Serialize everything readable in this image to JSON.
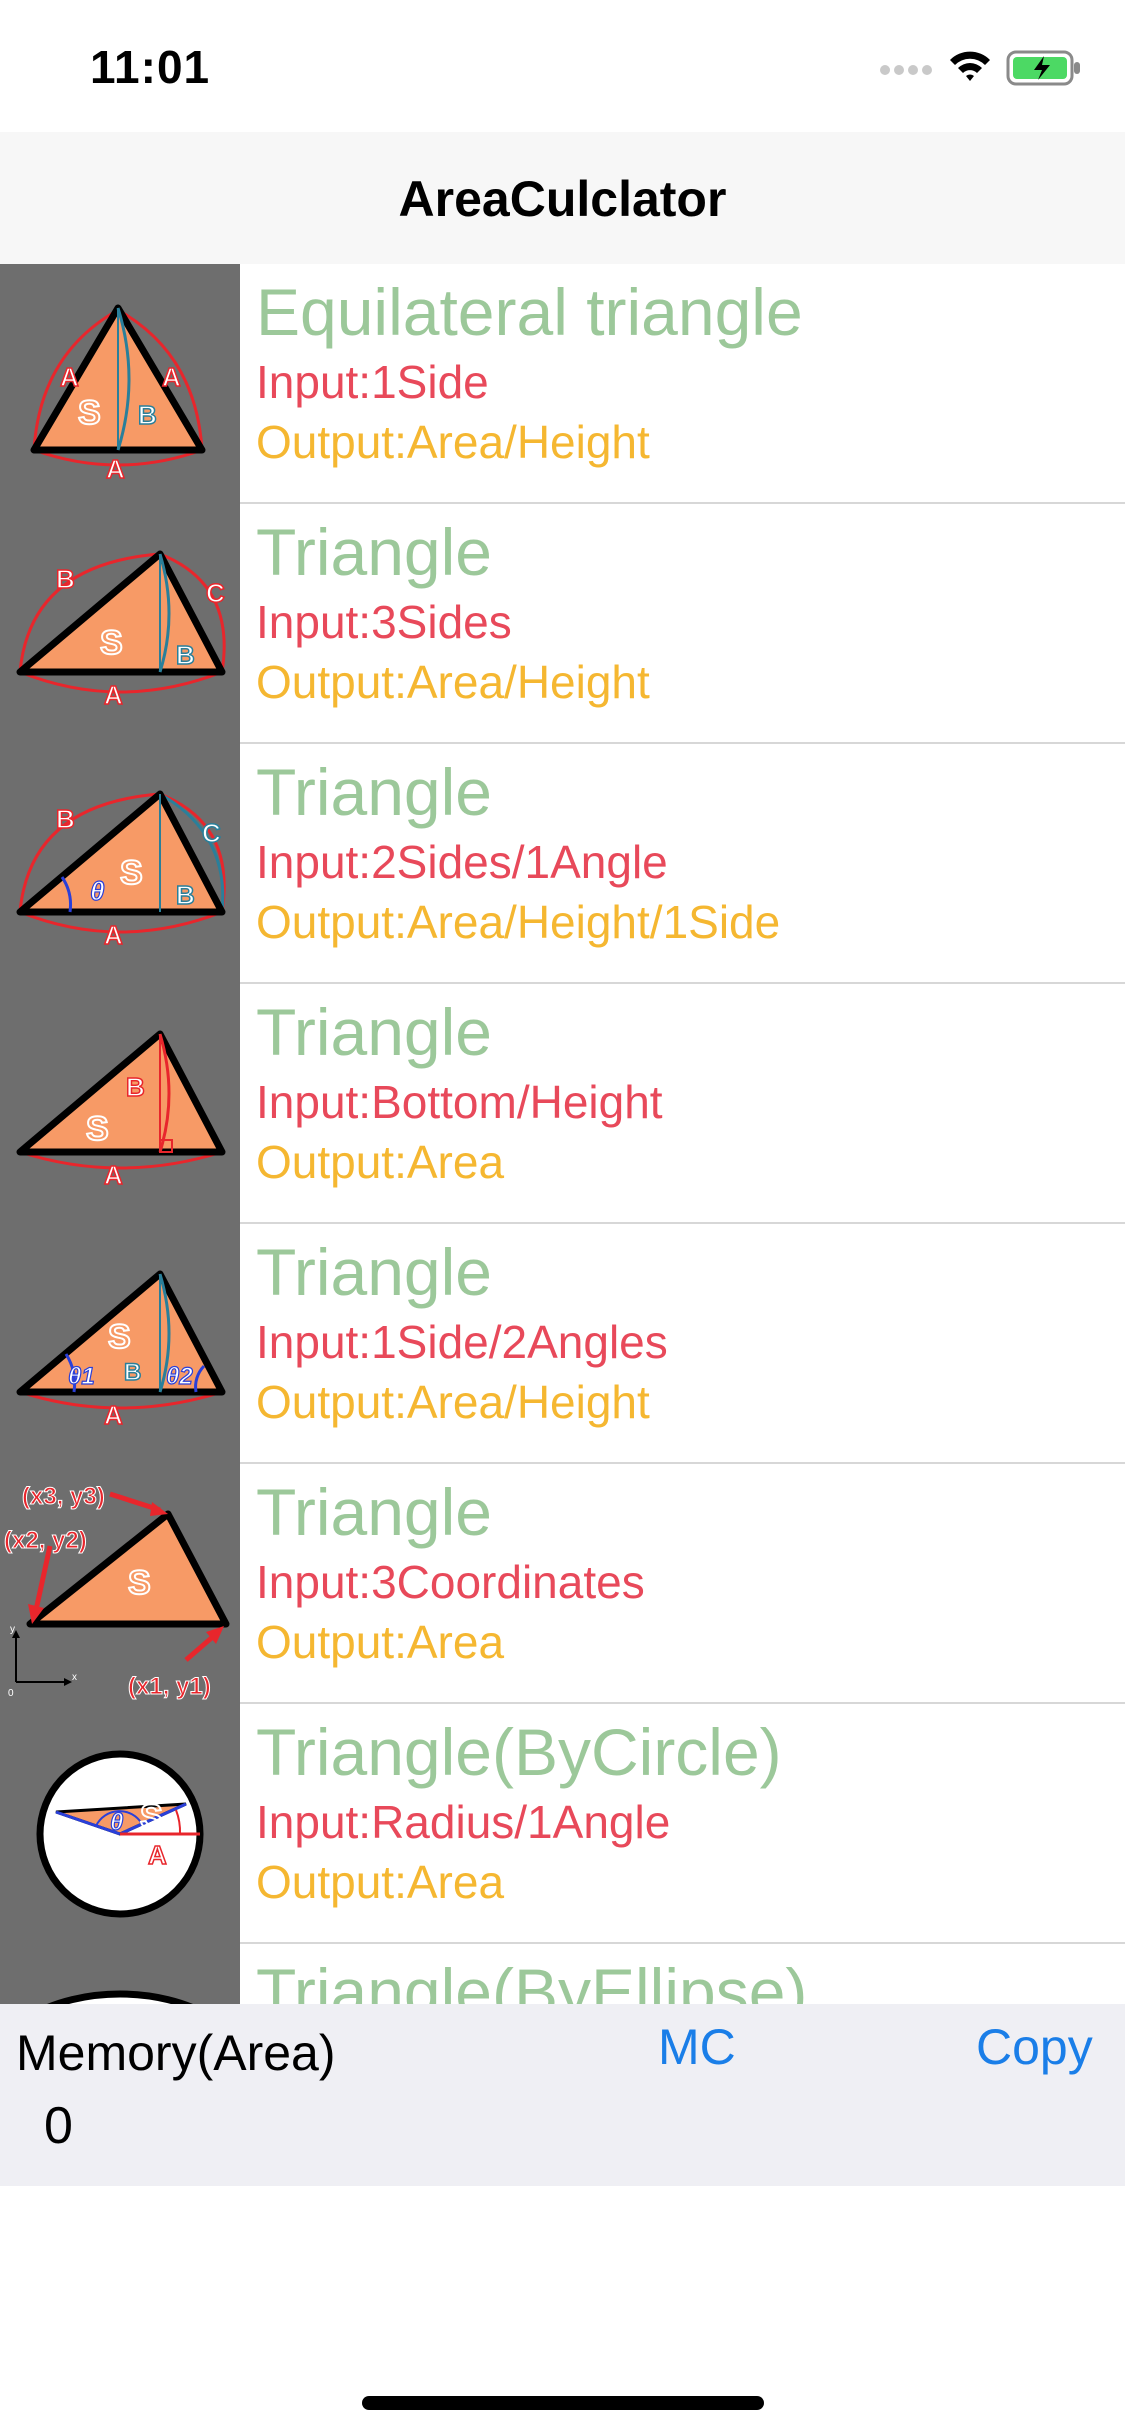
{
  "status_bar": {
    "time": "11:01"
  },
  "nav": {
    "title": "AreaCulclator"
  },
  "rows": [
    {
      "title": "Equilateral triangle",
      "input": "Input:1Side",
      "output": "Output:Area/Height",
      "icon": "equilateral-triangle-icon"
    },
    {
      "title": "Triangle",
      "input": "Input:3Sides",
      "output": "Output:Area/Height",
      "icon": "triangle-3sides-icon"
    },
    {
      "title": "Triangle",
      "input": "Input:2Sides/1Angle",
      "output": "Output:Area/Height/1Side",
      "icon": "triangle-2sides-angle-icon"
    },
    {
      "title": "Triangle",
      "input": "Input:Bottom/Height",
      "output": "Output:Area",
      "icon": "triangle-bottom-height-icon"
    },
    {
      "title": "Triangle",
      "input": "Input:1Side/2Angles",
      "output": "Output:Area/Height",
      "icon": "triangle-side-2angles-icon"
    },
    {
      "title": "Triangle",
      "input": "Input:3Coordinates",
      "output": "Output:Area",
      "icon": "triangle-coordinates-icon"
    },
    {
      "title": "Triangle(ByCircle)",
      "input": "Input:Radius/1Angle",
      "output": "Output:Area",
      "icon": "triangle-circle-icon"
    },
    {
      "title": "Triangle(ByEllipse)",
      "input": "",
      "output": "",
      "icon": "triangle-ellipse-icon"
    }
  ],
  "thumb_labels": {
    "side_a": "A",
    "side_b": "B",
    "side_c": "C",
    "area": "S",
    "theta": "θ",
    "theta1": "θ1",
    "theta2": "θ2",
    "coord1": "(x1, y1)",
    "coord2": "(x2, y2)",
    "coord3": "(x3, y3)",
    "axis_x": "x",
    "axis_y": "y",
    "origin": "0"
  },
  "memory": {
    "label": "Memory(Area)",
    "value": "0",
    "mc_label": "MC",
    "copy_label": "Copy"
  },
  "colors": {
    "title": "#9cc89a",
    "input": "#e8495a",
    "output": "#f5b731",
    "button": "#1a7ee8",
    "thumb_bg": "#6e6e6e",
    "shape_fill": "#f79a66",
    "battery": "#4cd964"
  }
}
